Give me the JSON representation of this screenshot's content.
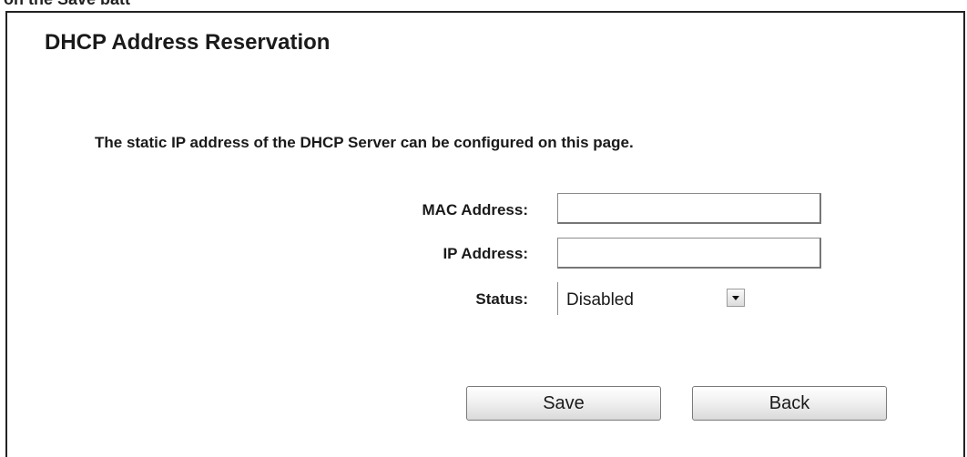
{
  "top_fragment": "on the Save batt",
  "page": {
    "title": "DHCP Address Reservation",
    "description": "The static IP address of the DHCP Server can be configured on this page."
  },
  "form": {
    "mac_label": "MAC Address:",
    "mac_value": "",
    "ip_label": "IP Address:",
    "ip_value": "",
    "status_label": "Status:",
    "status_selected": "Disabled"
  },
  "buttons": {
    "save_label": "Save",
    "back_label": "Back"
  },
  "colors": {
    "border": "#222222",
    "field_border": "#8a8a8a",
    "button_border": "#7a7a7a",
    "text": "#1a1a1a"
  },
  "icons": {
    "dropdown": "chevron-down-icon"
  }
}
